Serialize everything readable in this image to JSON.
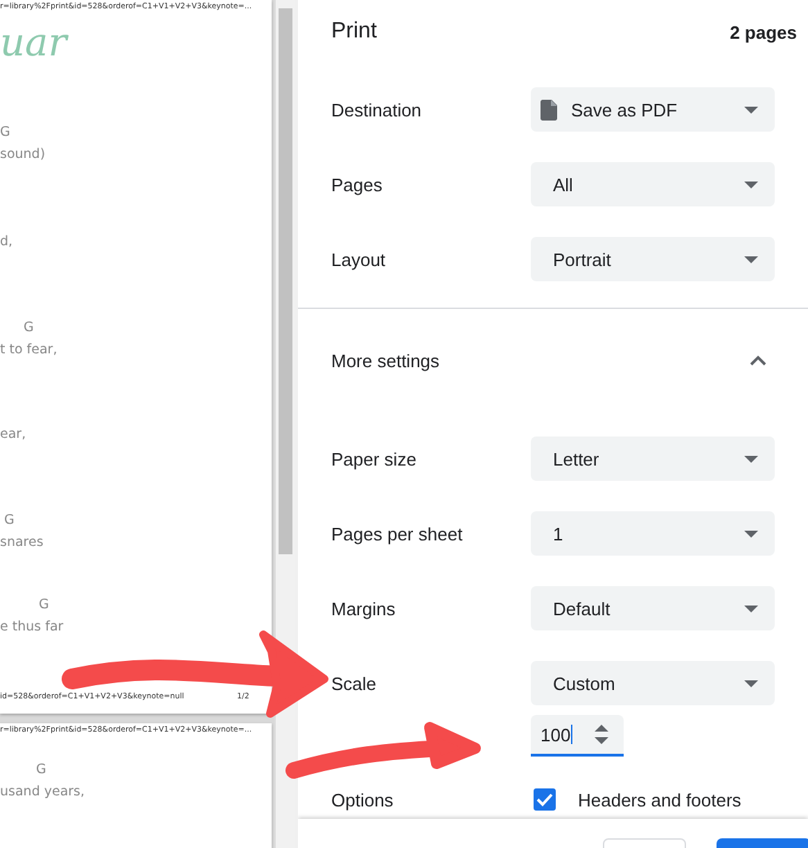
{
  "preview": {
    "pages": [
      {
        "header": "r=library%2Fprint&id=528&orderof=C1+V1+V2+V3&keynote=...",
        "title": "uar",
        "blocks": [
          {
            "chord": "G",
            "lyric": "sound)"
          },
          {
            "lyric": "d,"
          },
          {
            "chord": "G",
            "lyric": "t to fear,"
          },
          {
            "lyric": "ear,"
          },
          {
            "chord": "G",
            "lyric": "snares"
          },
          {
            "chord": "G",
            "lyric": "e thus far"
          }
        ],
        "footer": {
          "url": "id=528&orderof=C1+V1+V2+V3&keynote=null",
          "page": "1/2"
        }
      },
      {
        "header": "r=library%2Fprint&id=528&orderof=C1+V1+V2+V3&keynote=...",
        "blocks": [
          {
            "chord": "G",
            "lyric": "usand years,"
          }
        ]
      }
    ]
  },
  "print": {
    "title": "Print",
    "page_count": "2 pages",
    "settings": [
      {
        "label": "Destination",
        "value": "Save as PDF",
        "kind": "destination"
      },
      {
        "label": "Pages",
        "value": "All",
        "kind": "select"
      },
      {
        "label": "Layout",
        "value": "Portrait",
        "kind": "select"
      }
    ],
    "more_settings": {
      "label": "More settings",
      "expanded": true
    },
    "more": [
      {
        "label": "Paper size",
        "value": "Letter",
        "kind": "select"
      },
      {
        "label": "Pages per sheet",
        "value": "1",
        "kind": "select"
      },
      {
        "label": "Margins",
        "value": "Default",
        "kind": "select"
      },
      {
        "label": "Scale",
        "value": "Custom",
        "kind": "select"
      }
    ],
    "scale_input": {
      "value": "100"
    },
    "options": {
      "label": "Options",
      "checkbox": {
        "label": "Headers and footers",
        "checked": true
      }
    },
    "buttons": [
      {
        "kind": "outline"
      },
      {
        "kind": "primary"
      }
    ]
  }
}
